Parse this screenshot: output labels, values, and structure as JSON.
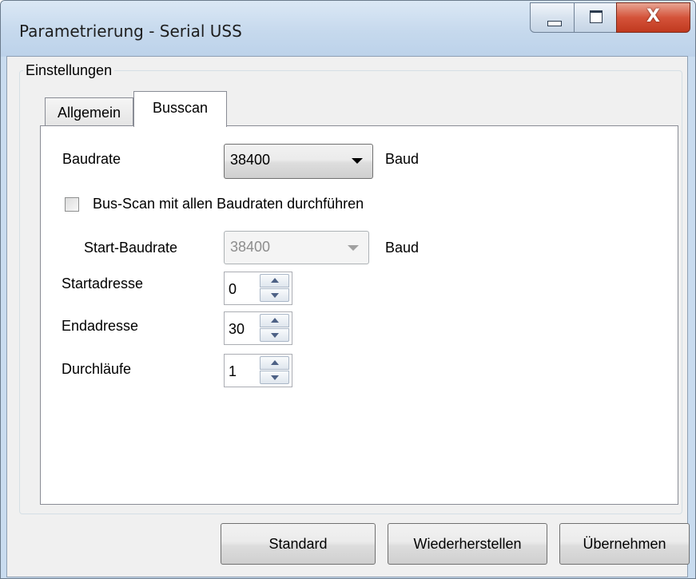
{
  "window": {
    "title": "Parametrierung - Serial USS",
    "caption_buttons": {
      "minimize_icon": "minimize-icon",
      "maximize_icon": "maximize-icon",
      "close_icon": "close-icon",
      "close_glyph": "X"
    }
  },
  "group": {
    "label": "Einstellungen"
  },
  "tabs": [
    {
      "label": "Allgemein",
      "selected": false
    },
    {
      "label": "Busscan",
      "selected": true
    }
  ],
  "busscan": {
    "baudrate": {
      "label": "Baudrate",
      "value": "38400",
      "unit": "Baud"
    },
    "scan_all": {
      "label": "Bus-Scan mit allen Baudraten durchführen",
      "checked": false
    },
    "start_baudrate": {
      "label": "Start-Baudrate",
      "value": "38400",
      "unit": "Baud",
      "enabled": false
    },
    "start_address": {
      "label": "Startadresse",
      "value": "0"
    },
    "end_address": {
      "label": "Endadresse",
      "value": "30"
    },
    "passes": {
      "label": "Durchläufe",
      "value": "1"
    }
  },
  "buttons": {
    "standard": "Standard",
    "restore": "Wiederherstellen",
    "apply": "Übernehmen"
  }
}
